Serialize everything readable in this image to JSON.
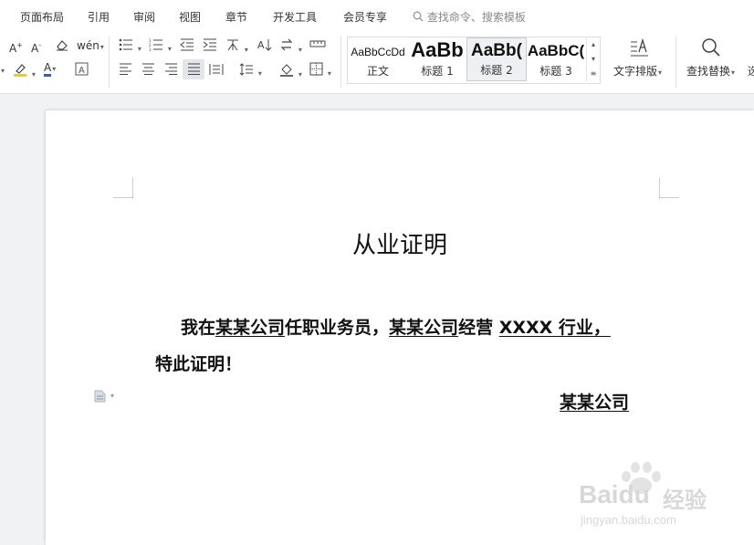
{
  "menu": {
    "items": [
      "页面布局",
      "引用",
      "审阅",
      "视图",
      "章节",
      "开发工具",
      "会员专享"
    ],
    "search_placeholder": "查找命令、搜索模板"
  },
  "toolbar": {
    "styles": [
      {
        "sample": "AaBbCcDd",
        "label": "正文"
      },
      {
        "sample": "AaBb",
        "label": "标题 1"
      },
      {
        "sample": "AaBb(",
        "label": "标题 2"
      },
      {
        "sample": "AaBbC(",
        "label": "标题 3"
      }
    ],
    "text_layout_label": "文字排版",
    "find_replace_label": "查找替换",
    "cut_off_label": "选"
  },
  "document": {
    "title": "从业证明",
    "line1": {
      "p1": "我在",
      "company1": "某某公司",
      "p2": "任职业务员，",
      "company2": "某某公司",
      "p3": "经营 ",
      "industry": "XXXX 行业，"
    },
    "line2": "特此证明！",
    "signature": "某某公司"
  },
  "watermark": {
    "brand": "Baidu",
    "cn": "经验",
    "url": "jingyan.baidu.com"
  },
  "colors": {
    "highlight": "#f2d200",
    "font_color": "#e02020",
    "accent": "#2b5ce6"
  }
}
